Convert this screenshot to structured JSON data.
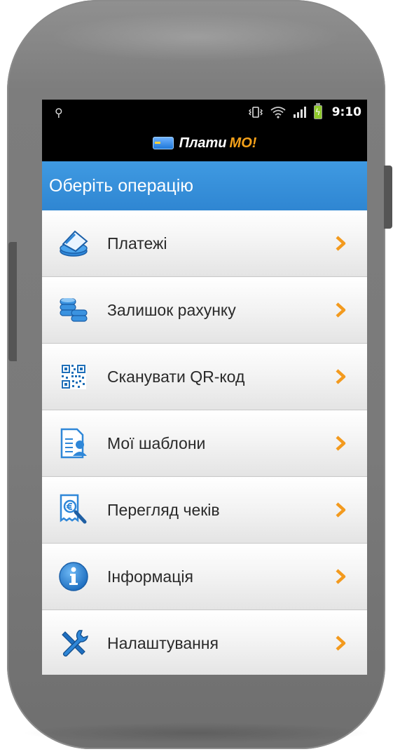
{
  "status_bar": {
    "usb_icon": "usb-icon",
    "time": "9:10",
    "battery_color": "#8fca2a"
  },
  "app_bar": {
    "logo_part1": "Плати",
    "logo_part2": "МО!",
    "logo_part2_color": "#f6a21a"
  },
  "header": {
    "title": "Оберіть операцію",
    "color": "#3a93dd"
  },
  "menu": {
    "items": [
      {
        "label": "Платежі",
        "icon": "payment-card-icon"
      },
      {
        "label": "Залишок рахунку",
        "icon": "coins-stack-icon"
      },
      {
        "label": "Сканувати QR-код",
        "icon": "qr-code-icon"
      },
      {
        "label": "Мої шаблони",
        "icon": "templates-document-icon"
      },
      {
        "label": "Перегляд чеків",
        "icon": "receipt-search-icon"
      },
      {
        "label": "Інформація",
        "icon": "info-icon"
      },
      {
        "label": "Налаштування",
        "icon": "tools-icon"
      }
    ],
    "chevron_color": "#f39a1e"
  }
}
